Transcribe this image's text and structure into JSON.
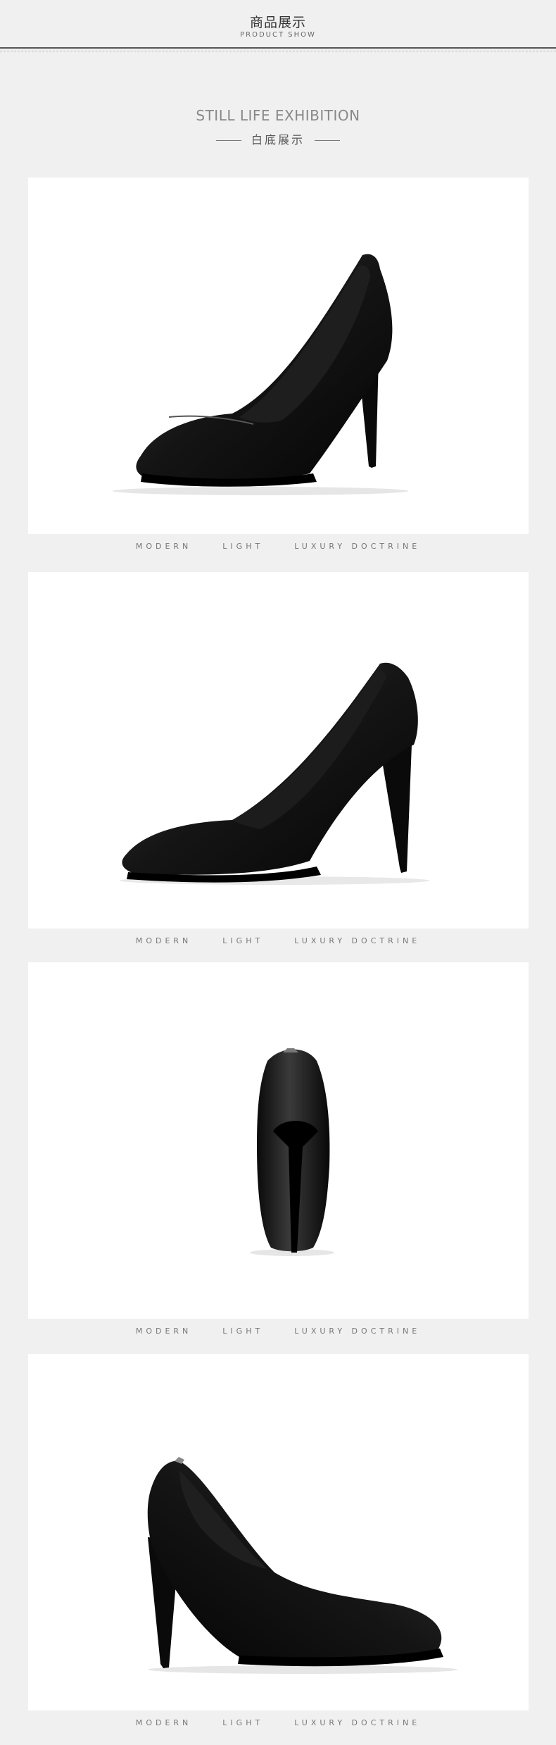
{
  "header": {
    "title": "商品展示",
    "subtitle": "PRODUCT SHOW"
  },
  "section": {
    "title": "STILL LIFE EXHIBITION",
    "subtitle": "白底展示"
  },
  "caption": {
    "word1": "MODERN",
    "word2": "LIGHT",
    "word3": "LUXURY DOCTRINE"
  },
  "colors": {
    "background": "#f0f0f0",
    "card": "#ffffff",
    "shoe": "#111111"
  }
}
